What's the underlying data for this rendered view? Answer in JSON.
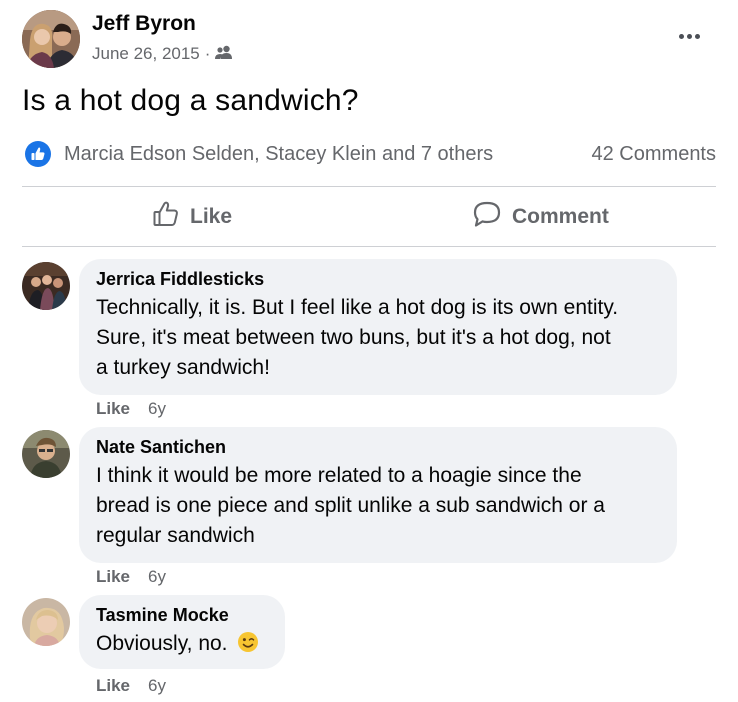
{
  "post": {
    "author": "Jeff Byron",
    "date": "June 26, 2015",
    "separator": "·",
    "audience_icon": "friends-icon",
    "text": "Is a hot dog a sandwich?",
    "reactions": {
      "icon": "like-reaction-icon",
      "names": "Marcia Edson Selden, Stacey Klein and 7 others",
      "comments": "42 Comments"
    },
    "actions": {
      "like_label": "Like",
      "comment_label": "Comment"
    }
  },
  "comments": [
    {
      "name": "Jerrica Fiddlesticks",
      "lines": [
        "Technically, it is. But I feel like a hot dog is its own entity.",
        "Sure, it's meat between two buns, but it's a hot dog, not",
        "a turkey sandwich!"
      ],
      "like_label": "Like",
      "time": "6y"
    },
    {
      "name": "Nate Santichen",
      "lines": [
        "I think it would be more related to a hoagie since the",
        "bread is one piece and split unlike a sub sandwich or a",
        "regular sandwich"
      ],
      "like_label": "Like",
      "time": "6y"
    },
    {
      "name": "Tasmine Mocke",
      "lines": [
        "Obviously, no."
      ],
      "emoji": "winking-face-emoji",
      "like_label": "Like",
      "time": "6y"
    }
  ],
  "colors": {
    "accent_blue": "#1a74e6",
    "secondary_text": "#65676b",
    "bubble_bg": "#f0f2f5",
    "divider": "#ced0d4"
  }
}
